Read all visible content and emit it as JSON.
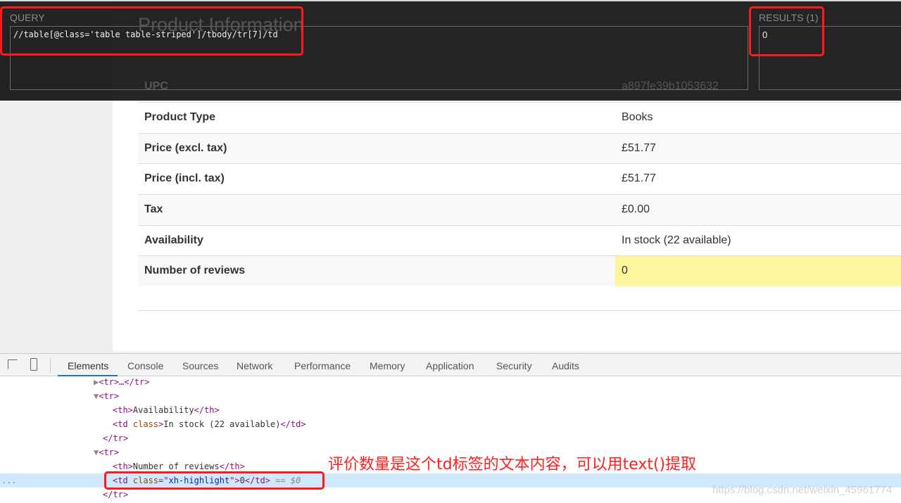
{
  "page": {
    "title": "Product Information",
    "rows": [
      {
        "th": "UPC",
        "td": "a897fe39b1053632"
      },
      {
        "th": "Product Type",
        "td": "Books"
      },
      {
        "th": "Price (excl. tax)",
        "td": "£51.77"
      },
      {
        "th": "Price (incl. tax)",
        "td": "£51.77"
      },
      {
        "th": "Tax",
        "td": "£0.00"
      },
      {
        "th": "Availability",
        "td": "In stock (22 available)"
      },
      {
        "th": "Number of reviews",
        "td": "0"
      }
    ]
  },
  "xpath_helper": {
    "query_label": "QUERY",
    "query": "//table[@class='table table-striped']/tbody/tr[7]/td",
    "results_label": "RESULTS (1)",
    "result": "0"
  },
  "devtools": {
    "tabs": [
      "Elements",
      "Console",
      "Sources",
      "Network",
      "Performance",
      "Memory",
      "Application",
      "Security",
      "Audits"
    ],
    "active_tab": "Elements",
    "dom": {
      "l0": "<tr>…</tr>",
      "l1": "<tr>",
      "l2a": "<th>",
      "l2b": "Availability",
      "l2c": "</th>",
      "l3a": "<td ",
      "l3b": "class",
      "l3c": ">",
      "l3d": "In stock (22 available)",
      "l3e": "</td>",
      "l4": "</tr>",
      "l5": "<tr>",
      "l6a": "<th>",
      "l6b": "Number of reviews",
      "l6c": "</th>",
      "l7a": "<td ",
      "l7b": "class",
      "l7c": "=\"",
      "l7d": "xh-highlight",
      "l7e": "\">",
      "l7f": "0",
      "l7g": "</td>",
      "l7h": " == $0",
      "l8": "</tr>",
      "ellipsis": "..."
    }
  },
  "annotation": "评价数量是这个td标签的文本内容，可以用text()提取",
  "watermark": "https://blog.csdn.net/weixin_45961774",
  "colors": {
    "highlight": "#fff59d",
    "annotation": "#ff1a1a",
    "selected_line": "#cfe8fc"
  }
}
